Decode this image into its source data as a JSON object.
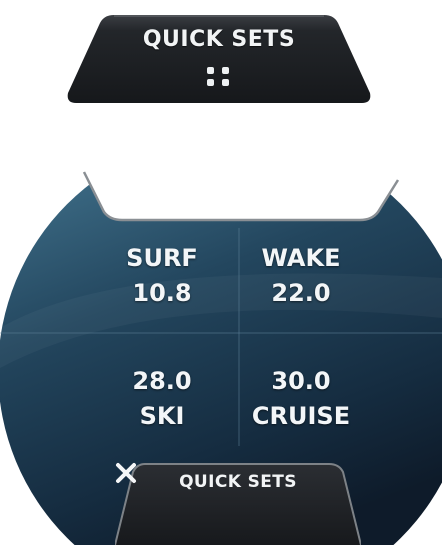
{
  "quick_sets_tab": {
    "label": "QUICK SETS",
    "icon": "grip-dots-icon"
  },
  "presets": [
    {
      "name": "SURF",
      "value": "10.8"
    },
    {
      "name": "WAKE",
      "value": "22.0"
    },
    {
      "name": "SKI",
      "value": "28.0"
    },
    {
      "name": "CRUISE",
      "value": "30.0"
    }
  ],
  "close_tab": {
    "label": "QUICK SETS",
    "icon": "close-icon"
  },
  "colors": {
    "tab_fill": "#1b1d20",
    "panel_top": "#3a6a84",
    "panel_bottom": "#0f1d2c",
    "text": "#f3f6f8"
  }
}
